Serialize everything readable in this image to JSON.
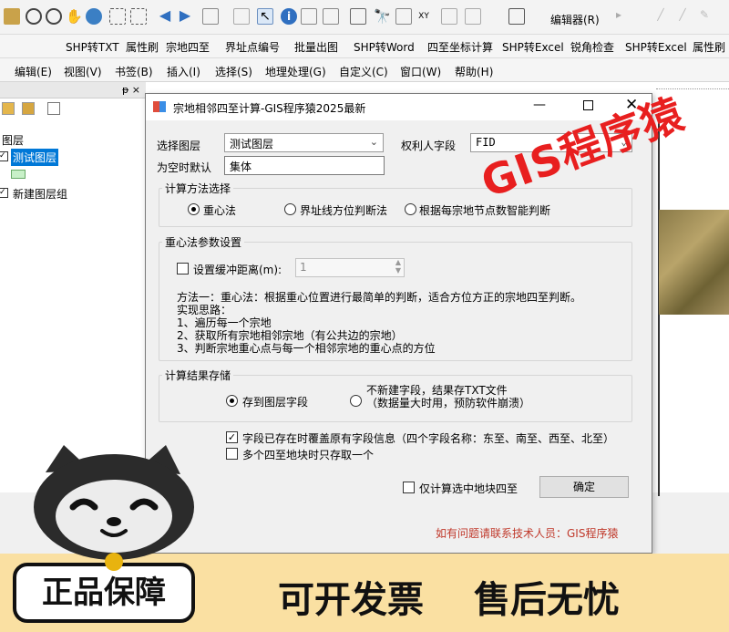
{
  "toolbar_row2": {
    "items": [
      "SHP转TXT",
      "属性刷",
      "宗地四至",
      "界址点编号",
      "批量出图",
      "SHP转Word",
      "四至坐标计算",
      "SHP转Excel",
      "锐角检查",
      "SHP转Excel",
      "属性刷"
    ],
    "editor_label": "编辑器(R)"
  },
  "menu": [
    "编辑(E)",
    "视图(V)",
    "书签(B)",
    "插入(I)",
    "选择(S)",
    "地理处理(G)",
    "自定义(C)",
    "窗口(W)",
    "帮助(H)"
  ],
  "toc": {
    "root": "图层",
    "layer": "测试图层",
    "group": "新建图层组",
    "pin": "ᵽ ×"
  },
  "dialog": {
    "title": "宗地相邻四至计算-GIS程序猿2025最新",
    "select_layer_label": "选择图层",
    "select_layer_value": "测试图层",
    "owner_field_label": "权利人字段",
    "owner_field_value": "FID",
    "empty_default_label": "为空时默认",
    "empty_default_value": "集体",
    "method_group": "计算方法选择",
    "methods": [
      "重心法",
      "界址线方位判断法",
      "根据每宗地节点数智能判断"
    ],
    "params_group": "重心法参数设置",
    "buffer_label": "设置缓冲距离(m):",
    "buffer_value": "1",
    "desc": [
      "方法一：重心法：根据重心位置进行最简单的判断，适合方位方正的宗地四至判断。",
      "实现思路：",
      "1、遍历每一个宗地",
      "2、获取所有宗地相邻宗地（有公共边的宗地）",
      "3、判断宗地重心点与每一个相邻宗地的重心点的方位"
    ],
    "storage_group": "计算结果存储",
    "store_field": "存到图层字段",
    "store_txt_line1": "不新建字段，结果存TXT文件",
    "store_txt_line2": "（数据量大时用，预防软件崩溃）",
    "overwrite_label": "字段已存在时覆盖原有字段信息（四个字段名称：东至、南至、西至、北至）",
    "take_one_label": "多个四至地块时只存取一个",
    "selected_only_label": "仅计算选中地块四至",
    "ok_button": "确定",
    "contact": "如有问题请联系技术人员：GIS程序猿"
  },
  "watermark": "GIS程序猿",
  "promo": {
    "badge": "正品保障",
    "slogan1": "可开发票",
    "slogan2": "售后无忧"
  },
  "colors": {
    "accent_red": "#e81f1f",
    "contact_red": "#c0392b",
    "banner_bg": "#fae0a2",
    "selection_blue": "#0078d7"
  }
}
